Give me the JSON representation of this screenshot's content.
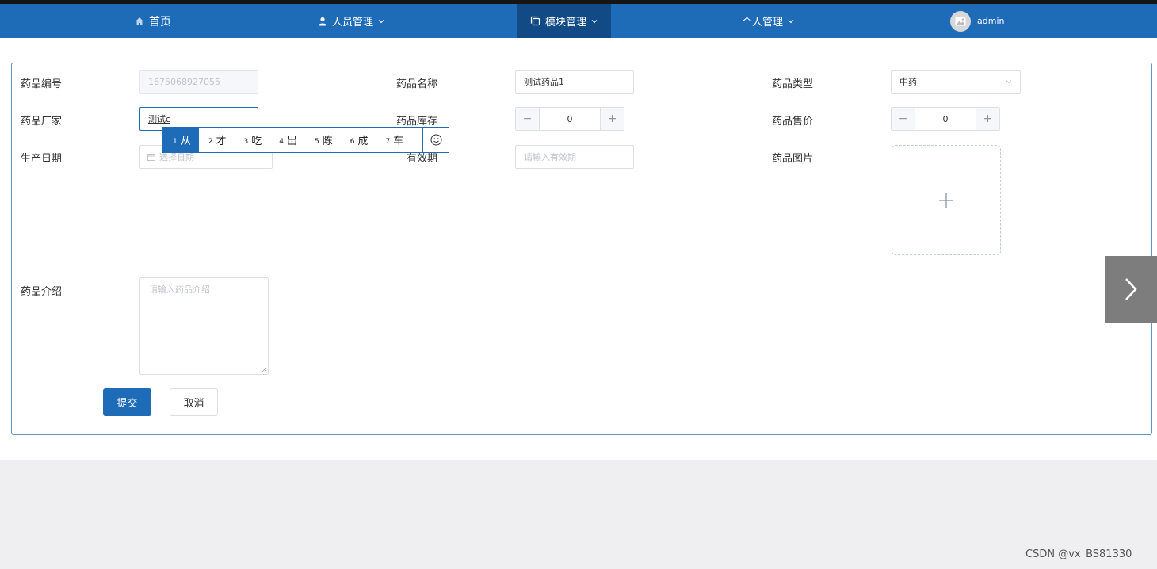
{
  "nav": {
    "home": "首页",
    "users": "人员管理",
    "modules": "模块管理",
    "personal": "个人管理",
    "username": "admin"
  },
  "form": {
    "code_label": "药品编号",
    "code_value": "1675068927055",
    "name_label": "药品名称",
    "name_value": "测试药品1",
    "type_label": "药品类型",
    "type_value": "中药",
    "maker_label": "药品厂家",
    "maker_value": "测试c",
    "stock_label": "药品库存",
    "stock_value": "0",
    "price_label": "药品售价",
    "price_value": "0",
    "prod_date_label": "生产日期",
    "prod_date_placeholder": "选择日期",
    "expiry_label": "有效期",
    "expiry_placeholder": "请输入有效期",
    "image_label": "药品图片",
    "intro_label": "药品介绍",
    "intro_placeholder": "请输入药品介绍",
    "submit": "提交",
    "cancel": "取消"
  },
  "ime": {
    "candidates": [
      {
        "num": "1",
        "char": "从"
      },
      {
        "num": "2",
        "char": "才"
      },
      {
        "num": "3",
        "char": "吃"
      },
      {
        "num": "4",
        "char": "出"
      },
      {
        "num": "5",
        "char": "陈"
      },
      {
        "num": "6",
        "char": "成"
      },
      {
        "num": "7",
        "char": "车"
      }
    ]
  },
  "watermark": "CSDN @vx_BS81330",
  "colors": {
    "nav_bg": "#1e6bb8",
    "nav_active": "#114a85",
    "primary": "#1e6bb8"
  }
}
